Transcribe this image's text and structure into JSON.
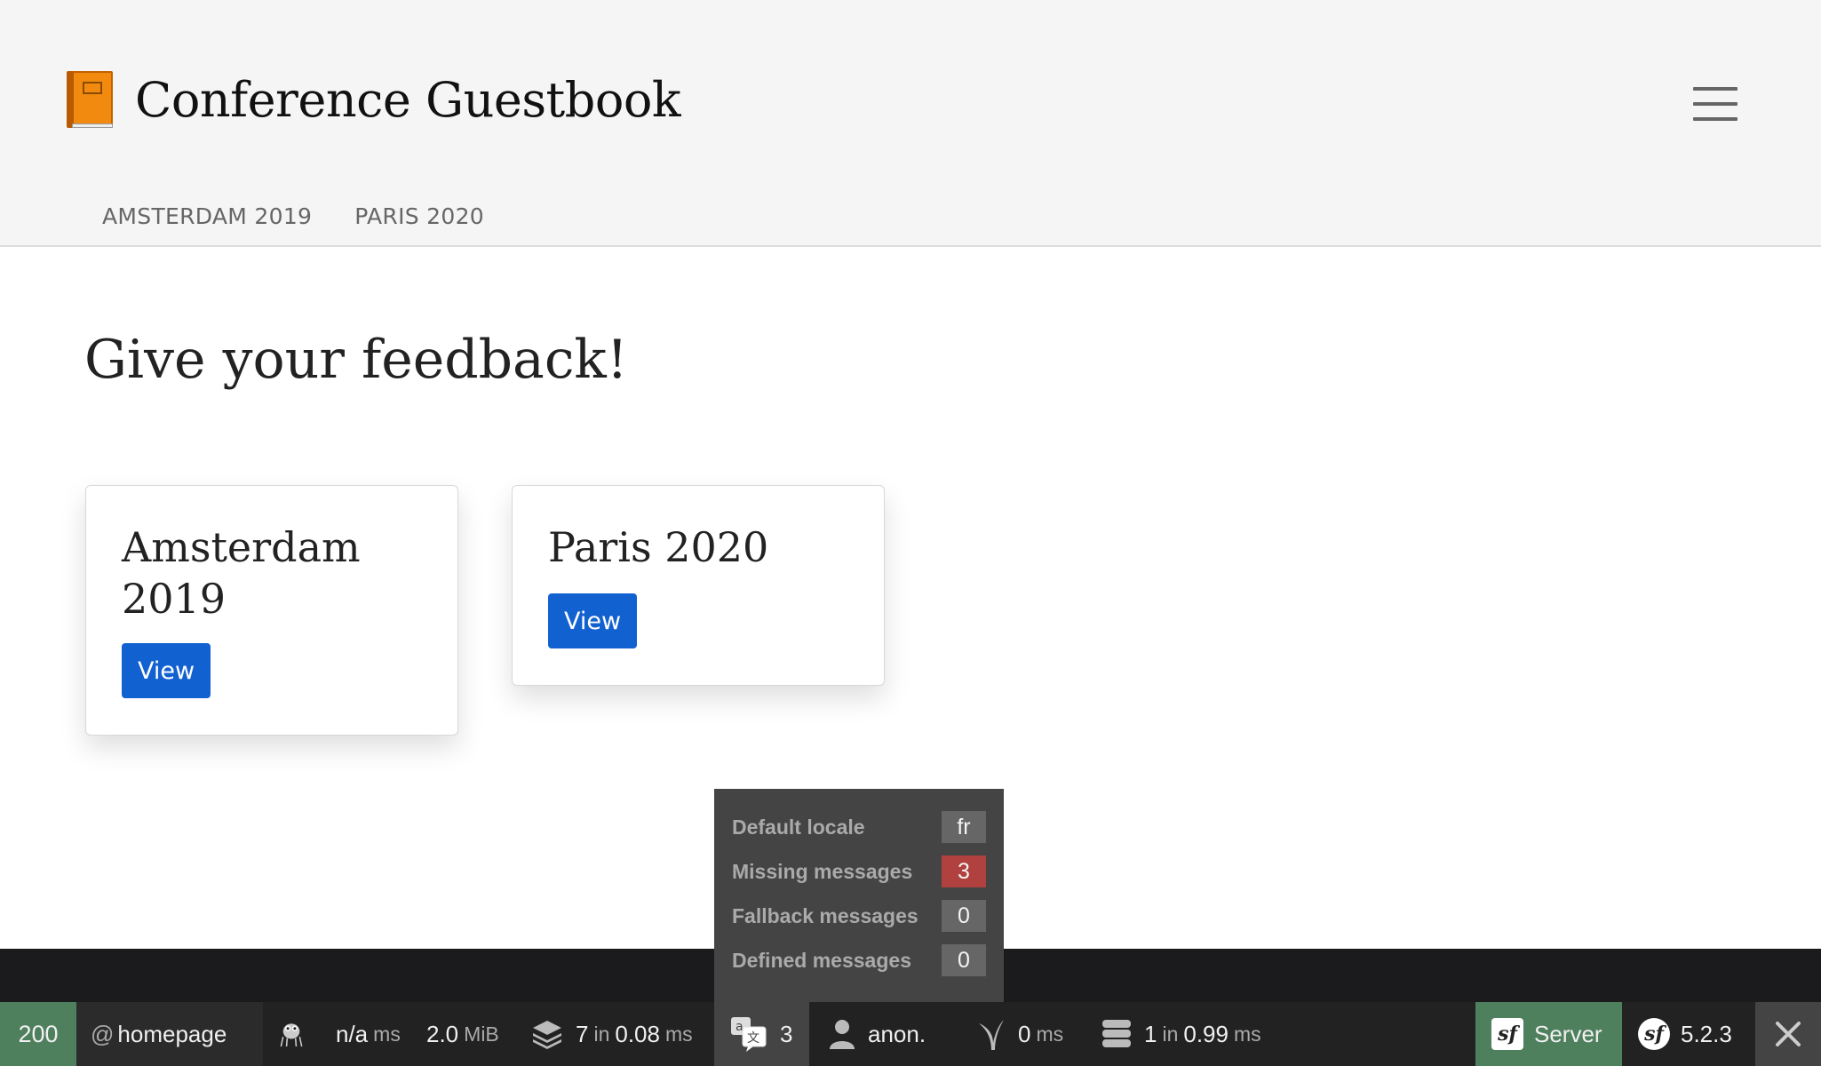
{
  "header": {
    "brand_title": "Conference Guestbook",
    "brand_icon": "orange-book-icon",
    "menu_icon": "hamburger-icon",
    "nav": [
      "AMSTERDAM 2019",
      "PARIS 2020"
    ]
  },
  "main": {
    "title": "Give your feedback!",
    "cards": [
      {
        "title": "Amsterdam 2019",
        "button": "View"
      },
      {
        "title": "Paris 2020",
        "button": "View"
      }
    ]
  },
  "debug_popup": {
    "rows": [
      {
        "label": "Default locale",
        "value": "fr"
      },
      {
        "label": "Missing messages",
        "value": "3"
      },
      {
        "label": "Fallback messages",
        "value": "0"
      },
      {
        "label": "Defined messages",
        "value": "0"
      }
    ],
    "highlight_color": "#b0413e"
  },
  "toolbar": {
    "status": "200",
    "route_prefix": "@",
    "route": "homepage",
    "time_value": "n/a",
    "time_unit": "ms",
    "memory_value": "2.0",
    "memory_unit": "MiB",
    "layers_count": "7",
    "layers_in": "in",
    "layers_time": "0.08",
    "layers_unit": "ms",
    "translation_count": "3",
    "user": "anon.",
    "stopwatch_value": "0",
    "stopwatch_unit": "ms",
    "db_count": "1",
    "db_in": "in",
    "db_time": "0.99",
    "db_unit": "ms",
    "server_label": "Server",
    "version": "5.2.3",
    "sf_logo_text": "sf",
    "status_color": "#4f805d"
  }
}
